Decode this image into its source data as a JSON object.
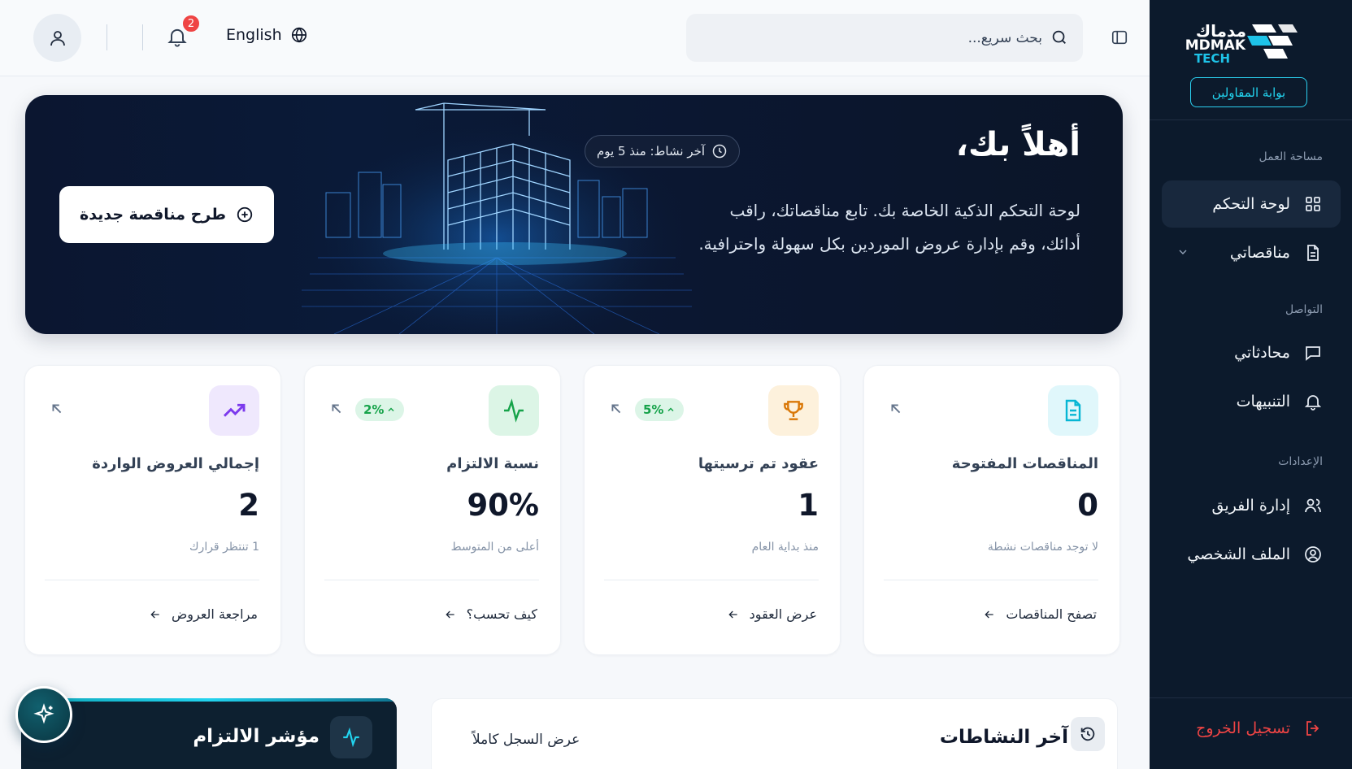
{
  "sidebar": {
    "logo_ar": "مدماك",
    "logo_en_1": "MDMAK",
    "logo_en_2": "TECH",
    "portal_label": "بوابة المقاولين",
    "sections": {
      "workspace": "مساحة العمل",
      "communication": "التواصل",
      "settings": "الإعدادات"
    },
    "items": [
      {
        "label": "لوحة التحكم",
        "icon": "grid-icon"
      },
      {
        "label": "مناقصاتي",
        "icon": "document-icon"
      },
      {
        "label": "محادثاتي",
        "icon": "chat-icon"
      },
      {
        "label": "التنبيهات",
        "icon": "bell-icon"
      },
      {
        "label": "إدارة الفريق",
        "icon": "users-icon"
      },
      {
        "label": "الملف الشخصي",
        "icon": "user-circle-icon"
      }
    ],
    "logout_label": "تسجيل الخروج"
  },
  "topbar": {
    "search_placeholder": "بحث سريع...",
    "language_label": "English",
    "notification_count": "2"
  },
  "hero": {
    "title": "أهلاً بك،",
    "description": "لوحة التحكم الذكية الخاصة بك. تابع مناقصاتك، راقب أدائك، وقم بإدارة عروض الموردين بكل سهولة واحترافية.",
    "last_activity": "آخر نشاط: منذ 5 يوم",
    "new_tender_label": "طرح مناقصة جديدة"
  },
  "stats": [
    {
      "title": "المناقصات المفتوحة",
      "value": "0",
      "subtitle": "لا توجد مناقصات نشطة",
      "link": "تصفح المناقصات",
      "trend": "",
      "icon": "document-icon",
      "color": "#06b6d4",
      "bg": "#e0f7fb"
    },
    {
      "title": "عقود تم ترسيتها",
      "value": "1",
      "subtitle": "منذ بداية العام",
      "link": "عرض العقود",
      "trend": "5%",
      "icon": "trophy-icon",
      "color": "#d97706",
      "bg": "#fdf1dc"
    },
    {
      "title": "نسبة الالتزام",
      "value": "90%",
      "subtitle": "أعلى من المتوسط",
      "link": "كيف تحسب؟",
      "trend": "2%",
      "icon": "activity-icon",
      "color": "#16a34a",
      "bg": "#dcf5e6"
    },
    {
      "title": "إجمالي العروض الواردة",
      "value": "2",
      "subtitle": "1 تنتظر قرارك",
      "link": "مراجعة العروض",
      "trend": "",
      "icon": "trending-up-icon",
      "color": "#7c3aed",
      "bg": "#efe8fd"
    }
  ],
  "panels": {
    "compliance_title": "مؤشر الالتزام",
    "activities_title": "آخر النشاطات",
    "activities_link": "عرض السجل كاملاً"
  },
  "colors": {
    "sidebar_bg": "#0c1a2c",
    "accent": "#22d3ee",
    "danger": "#ef4444"
  }
}
